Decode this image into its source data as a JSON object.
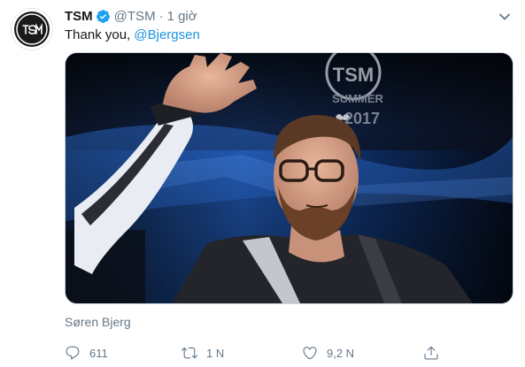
{
  "tweet": {
    "author_name": "TSM",
    "handle": "@TSM",
    "separator": "·",
    "time": "1 giờ",
    "text_prefix": "Thank you,",
    "mention": "@Bjergsen",
    "media_logo_text": "SUMMER",
    "media_year_text": "2017",
    "media_caption": "Søren Bjerg"
  },
  "actions": {
    "replies": "611",
    "retweets": "1 N",
    "likes": "9,2 N"
  },
  "icons": {
    "avatar": "tsm-logo-icon",
    "verified": "verified-badge-icon",
    "caret": "chevron-down-icon",
    "reply": "reply-icon",
    "retweet": "retweet-icon",
    "like": "heart-icon",
    "share": "share-icon"
  },
  "colors": {
    "link": "#1b95e0",
    "secondary_text": "#657786",
    "verified": "#1da1f2"
  }
}
